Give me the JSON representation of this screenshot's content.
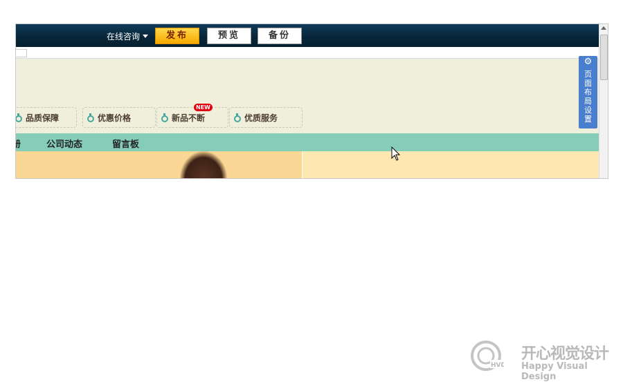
{
  "toolbar": {
    "consult_label": "在线咨询",
    "publish_label": "发布",
    "preview_label": "预览",
    "backup_label": "备份"
  },
  "features": [
    {
      "label": "品质保障",
      "icon": "refresh-icon"
    },
    {
      "label": "优惠价格",
      "icon": "refresh-icon"
    },
    {
      "label": "新品不断",
      "icon": "refresh-icon",
      "badge": "NEW"
    },
    {
      "label": "优质服务",
      "icon": "refresh-icon"
    }
  ],
  "nav": {
    "items": [
      "册",
      "公司动态",
      "留言板"
    ]
  },
  "layout_panel": {
    "label": "页面布局设置",
    "icon": "gear-icon"
  },
  "watermark": {
    "cn": "开心视觉设计",
    "en": "Happy Visual Design",
    "logo_text": "HVD"
  },
  "colors": {
    "toolbar_bg": "#082538",
    "publish_btn": "#f5a900",
    "header_bg": "#efefdc",
    "nav_bg": "#86cdb9",
    "banner_left": "#fbd795",
    "banner_right": "#fde8b2",
    "panel_blue": "#4a7fd0"
  }
}
